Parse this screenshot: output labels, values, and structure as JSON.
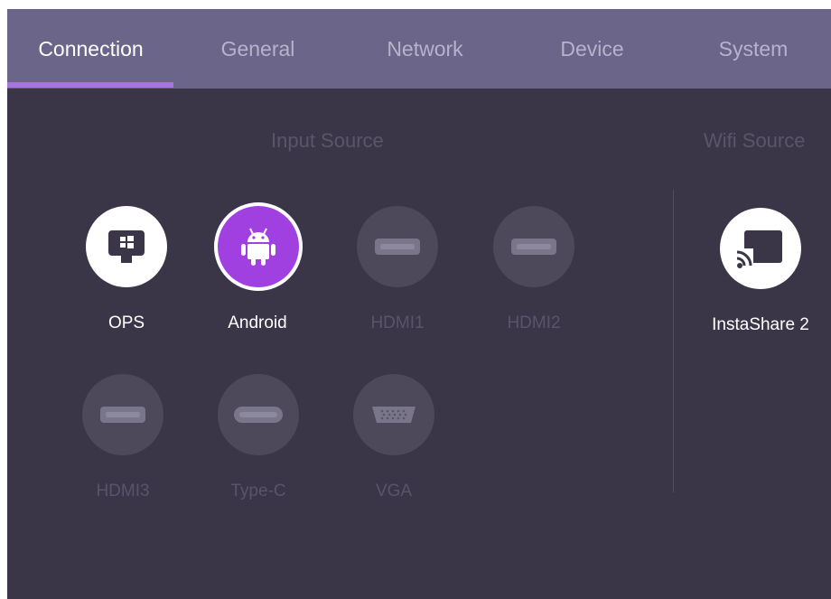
{
  "tabs": [
    {
      "label": "Connection",
      "active": true
    },
    {
      "label": "General",
      "active": false
    },
    {
      "label": "Network",
      "active": false
    },
    {
      "label": "Device",
      "active": false
    },
    {
      "label": "System",
      "active": false
    }
  ],
  "input_source": {
    "title": "Input Source",
    "items": [
      {
        "label": "OPS",
        "icon": "ops-windows-icon",
        "state": "available"
      },
      {
        "label": "Android",
        "icon": "android-icon",
        "state": "selected"
      },
      {
        "label": "HDMI1",
        "icon": "hdmi-port-icon",
        "state": "unavailable"
      },
      {
        "label": "HDMI2",
        "icon": "hdmi-port-icon",
        "state": "unavailable"
      },
      {
        "label": "HDMI3",
        "icon": "hdmi-port-icon",
        "state": "unavailable"
      },
      {
        "label": "Type-C",
        "icon": "type-c-port-icon",
        "state": "unavailable"
      },
      {
        "label": "VGA",
        "icon": "vga-port-icon",
        "state": "unavailable"
      }
    ]
  },
  "wifi_source": {
    "title": "Wifi Source",
    "items": [
      {
        "label": "InstaShare 2",
        "icon": "cast-icon",
        "state": "available"
      }
    ]
  },
  "colors": {
    "tabbar": "#6b6589",
    "background": "#3a3648",
    "accent": "#a874e0",
    "selected": "#a040e0"
  }
}
